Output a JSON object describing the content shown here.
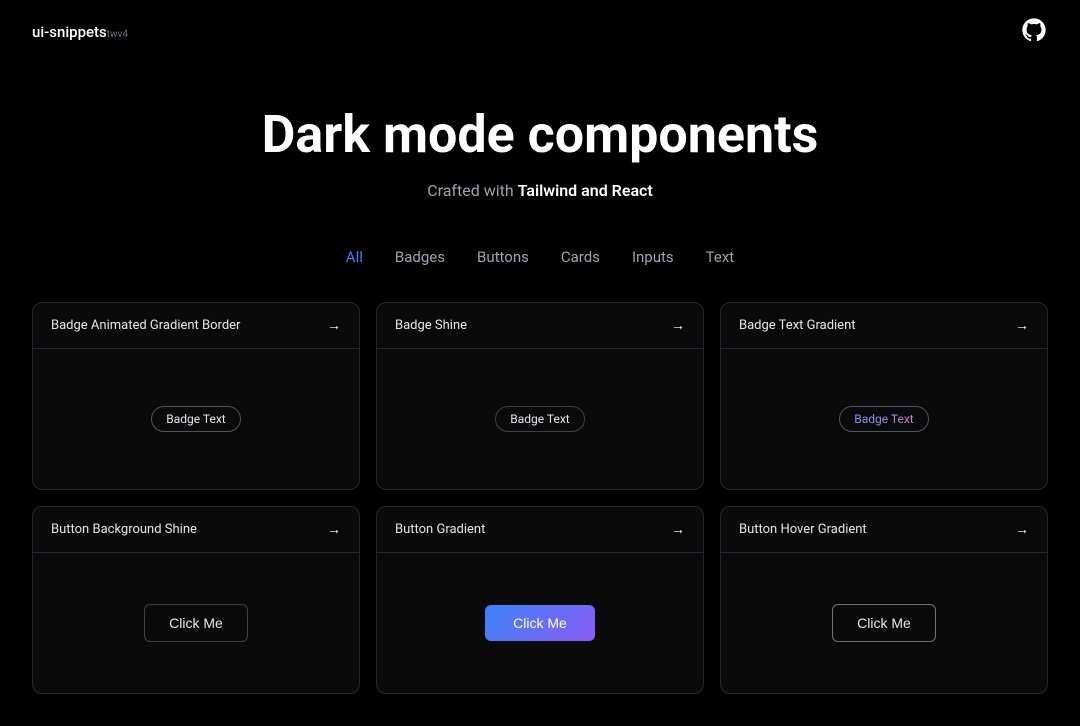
{
  "brand": {
    "name": "ui-snippets",
    "version": "twv4"
  },
  "hero": {
    "title": "Dark mode components",
    "subtitle_plain": "Crafted with ",
    "subtitle_bold": "Tailwind and React"
  },
  "filters": {
    "items": [
      {
        "label": "All",
        "active": true
      },
      {
        "label": "Badges",
        "active": false
      },
      {
        "label": "Buttons",
        "active": false
      },
      {
        "label": "Cards",
        "active": false
      },
      {
        "label": "Inputs",
        "active": false
      },
      {
        "label": "Text",
        "active": false
      }
    ]
  },
  "components": [
    {
      "title": "Badge Animated Gradient Border",
      "badge_text": "Badge Text",
      "type": "badge-animated"
    },
    {
      "title": "Badge Shine",
      "badge_text": "Badge Text",
      "type": "badge-shine"
    },
    {
      "title": "Badge Text Gradient",
      "badge_text": "Badge Text",
      "type": "badge-gradient"
    },
    {
      "title": "Button Background Shine",
      "button_text": "Click Me",
      "type": "btn-shine"
    },
    {
      "title": "Button Gradient",
      "button_text": "Click Me",
      "type": "btn-gradient"
    },
    {
      "title": "Button Hover Gradient",
      "button_text": "Click Me",
      "type": "btn-hover"
    }
  ],
  "icons": {
    "github": "github-icon",
    "arrow_right": "→"
  }
}
